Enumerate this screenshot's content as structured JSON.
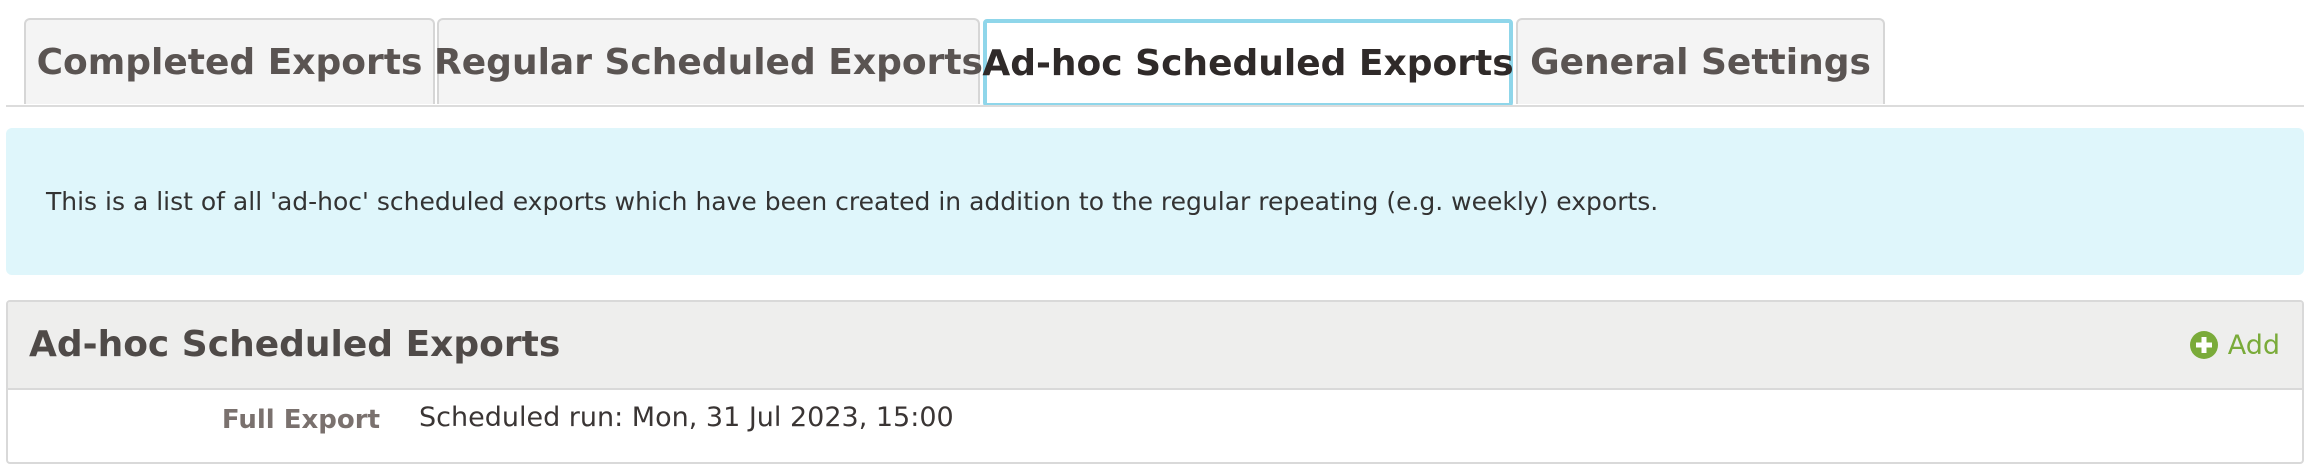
{
  "tabs": [
    {
      "label": "Completed Exports",
      "active": false
    },
    {
      "label": "Regular Scheduled Exports",
      "active": false
    },
    {
      "label": "Ad-hoc Scheduled Exports",
      "active": true
    },
    {
      "label": "General Settings",
      "active": false
    }
  ],
  "info": {
    "text": "This is a list of all 'ad-hoc' scheduled exports which have been created in addition to the regular repeating (e.g. weekly) exports."
  },
  "panel": {
    "title": "Ad-hoc Scheduled Exports",
    "add_label": "Add",
    "add_icon": "plus-circle-icon",
    "rows": [
      {
        "label": "Full Export",
        "value": "Scheduled run: Mon, 31 Jul 2023, 15:00"
      }
    ]
  },
  "colors": {
    "active_tab_border": "#8fd6ea",
    "info_background": "#dff6fb",
    "add_green": "#7aab3a",
    "panel_header_bg": "#eeeeed"
  }
}
